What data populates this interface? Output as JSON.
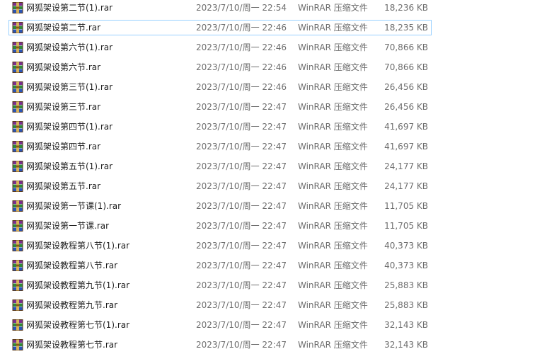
{
  "files": [
    {
      "name": "网狐架设第二节(1).rar",
      "modified": "2023/7/10/周一 22:54",
      "type": "WinRAR 压缩文件",
      "size": "18,236 KB",
      "icon": "winrar-archive-icon",
      "selected": false
    },
    {
      "name": "网狐架设第二节.rar",
      "modified": "2023/7/10/周一 22:46",
      "type": "WinRAR 压缩文件",
      "size": "18,235 KB",
      "icon": "winrar-archive-icon",
      "selected": true
    },
    {
      "name": "网狐架设第六节(1).rar",
      "modified": "2023/7/10/周一 22:46",
      "type": "WinRAR 压缩文件",
      "size": "70,866 KB",
      "icon": "winrar-archive-icon",
      "selected": false
    },
    {
      "name": "网狐架设第六节.rar",
      "modified": "2023/7/10/周一 22:46",
      "type": "WinRAR 压缩文件",
      "size": "70,866 KB",
      "icon": "winrar-archive-icon",
      "selected": false
    },
    {
      "name": "网狐架设第三节(1).rar",
      "modified": "2023/7/10/周一 22:46",
      "type": "WinRAR 压缩文件",
      "size": "26,456 KB",
      "icon": "winrar-archive-icon",
      "selected": false
    },
    {
      "name": "网狐架设第三节.rar",
      "modified": "2023/7/10/周一 22:47",
      "type": "WinRAR 压缩文件",
      "size": "26,456 KB",
      "icon": "winrar-archive-icon",
      "selected": false
    },
    {
      "name": "网狐架设第四节(1).rar",
      "modified": "2023/7/10/周一 22:47",
      "type": "WinRAR 压缩文件",
      "size": "41,697 KB",
      "icon": "winrar-archive-icon",
      "selected": false
    },
    {
      "name": "网狐架设第四节.rar",
      "modified": "2023/7/10/周一 22:47",
      "type": "WinRAR 压缩文件",
      "size": "41,697 KB",
      "icon": "winrar-archive-icon",
      "selected": false
    },
    {
      "name": "网狐架设第五节(1).rar",
      "modified": "2023/7/10/周一 22:47",
      "type": "WinRAR 压缩文件",
      "size": "24,177 KB",
      "icon": "winrar-archive-icon",
      "selected": false
    },
    {
      "name": "网狐架设第五节.rar",
      "modified": "2023/7/10/周一 22:47",
      "type": "WinRAR 压缩文件",
      "size": "24,177 KB",
      "icon": "winrar-archive-icon",
      "selected": false
    },
    {
      "name": "网狐架设第一节课(1).rar",
      "modified": "2023/7/10/周一 22:47",
      "type": "WinRAR 压缩文件",
      "size": "11,705 KB",
      "icon": "winrar-archive-icon",
      "selected": false
    },
    {
      "name": "网狐架设第一节课.rar",
      "modified": "2023/7/10/周一 22:47",
      "type": "WinRAR 压缩文件",
      "size": "11,705 KB",
      "icon": "winrar-archive-icon",
      "selected": false
    },
    {
      "name": "网狐架设教程第八节(1).rar",
      "modified": "2023/7/10/周一 22:47",
      "type": "WinRAR 压缩文件",
      "size": "40,373 KB",
      "icon": "winrar-archive-icon",
      "selected": false
    },
    {
      "name": "网狐架设教程第八节.rar",
      "modified": "2023/7/10/周一 22:47",
      "type": "WinRAR 压缩文件",
      "size": "40,373 KB",
      "icon": "winrar-archive-icon",
      "selected": false
    },
    {
      "name": "网狐架设教程第九节(1).rar",
      "modified": "2023/7/10/周一 22:47",
      "type": "WinRAR 压缩文件",
      "size": "25,883 KB",
      "icon": "winrar-archive-icon",
      "selected": false
    },
    {
      "name": "网狐架设教程第九节.rar",
      "modified": "2023/7/10/周一 22:47",
      "type": "WinRAR 压缩文件",
      "size": "25,883 KB",
      "icon": "winrar-archive-icon",
      "selected": false
    },
    {
      "name": "网狐架设教程第七节(1).rar",
      "modified": "2023/7/10/周一 22:47",
      "type": "WinRAR 压缩文件",
      "size": "32,143 KB",
      "icon": "winrar-archive-icon",
      "selected": false
    },
    {
      "name": "网狐架设教程第七节.rar",
      "modified": "2023/7/10/周一 22:47",
      "type": "WinRAR 压缩文件",
      "size": "32,143 KB",
      "icon": "winrar-archive-icon",
      "selected": false
    }
  ],
  "colors": {
    "selected_border": "#99d1ff",
    "name_text": "#1e1e1e",
    "detail_text": "#6d6d6d"
  }
}
